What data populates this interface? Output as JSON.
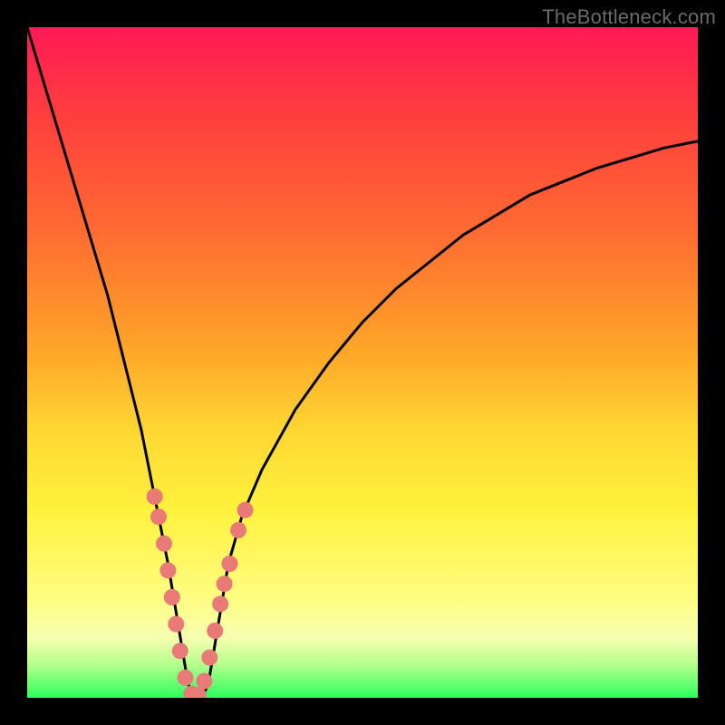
{
  "watermark": "TheBottleneck.com",
  "colors": {
    "frame": "#000000",
    "curve": "#000000",
    "dot": "#e97a78",
    "gradient_stops": [
      "#ff1a55",
      "#ff3b3f",
      "#ff6a32",
      "#ffa528",
      "#ffd633",
      "#fff23d",
      "#fffd80",
      "#f6ffb0",
      "#b6ff8d",
      "#2bff5c"
    ]
  },
  "chart_data": {
    "type": "line",
    "title": "",
    "xlabel": "",
    "ylabel": "",
    "xlim": [
      0,
      100
    ],
    "ylim": [
      0,
      100
    ],
    "series": [
      {
        "name": "bottleneck-curve",
        "x": [
          0,
          3,
          6,
          9,
          12,
          15,
          17,
          19,
          20,
          21,
          22,
          23,
          24,
          25,
          26,
          27,
          28,
          29,
          30,
          32,
          35,
          40,
          45,
          50,
          55,
          60,
          65,
          70,
          75,
          80,
          85,
          90,
          95,
          100
        ],
        "y": [
          100,
          90,
          80,
          70,
          60,
          48,
          40,
          30,
          25,
          20,
          14,
          8,
          2,
          0,
          0,
          2,
          8,
          14,
          20,
          27,
          34,
          43,
          50,
          56,
          61,
          65,
          69,
          72,
          75,
          77,
          79,
          80.5,
          82,
          83
        ]
      }
    ],
    "markers": [
      {
        "x": 19.0,
        "y": 30
      },
      {
        "x": 19.6,
        "y": 27
      },
      {
        "x": 20.4,
        "y": 23
      },
      {
        "x": 21.0,
        "y": 19
      },
      {
        "x": 21.6,
        "y": 15
      },
      {
        "x": 22.2,
        "y": 11
      },
      {
        "x": 22.8,
        "y": 7
      },
      {
        "x": 23.6,
        "y": 3
      },
      {
        "x": 24.5,
        "y": 0.6
      },
      {
        "x": 25.5,
        "y": 0.4
      },
      {
        "x": 26.4,
        "y": 2.5
      },
      {
        "x": 27.2,
        "y": 6
      },
      {
        "x": 28.0,
        "y": 10
      },
      {
        "x": 28.8,
        "y": 14
      },
      {
        "x": 29.4,
        "y": 17
      },
      {
        "x": 30.2,
        "y": 20
      },
      {
        "x": 31.5,
        "y": 25
      },
      {
        "x": 32.5,
        "y": 28
      }
    ]
  }
}
